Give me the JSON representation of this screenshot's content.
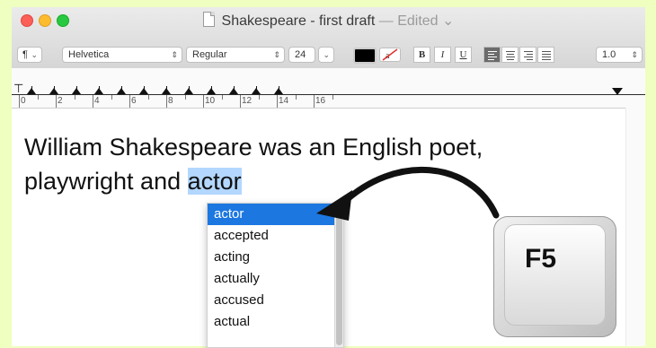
{
  "window": {
    "title": "Shakespeare - first draft",
    "title_separator": "—",
    "title_status": "Edited",
    "title_chevron": "⌄"
  },
  "toolbar": {
    "paragraph_styles": "¶",
    "font_family": "Helvetica",
    "font_style": "Regular",
    "font_size": "24",
    "bold": "B",
    "italic": "I",
    "underline": "U",
    "line_spacing": "1.0"
  },
  "ruler": {
    "labels": [
      "0",
      "2",
      "4",
      "6",
      "8",
      "10",
      "12",
      "14",
      "16"
    ]
  },
  "document": {
    "line1": "William Shakespeare was an English poet,",
    "line2_prefix": "playwright and ",
    "line2_selected": "actor"
  },
  "autocomplete": {
    "items": [
      "actor",
      "accepted",
      "acting",
      "actually",
      "accused",
      "actual"
    ],
    "highlighted_index": 0
  },
  "overlay": {
    "key_label": "F5"
  },
  "colors": {
    "background": "#efffbf",
    "selection_blue": "#1c77e0",
    "text_selection": "#b3d7ff",
    "text_color_swatch": "#000000"
  },
  "icons": {
    "close": "red-dot",
    "minimize": "yellow-dot",
    "zoom": "green-dot",
    "document": "document-icon",
    "arrow": "curved-arrow"
  }
}
